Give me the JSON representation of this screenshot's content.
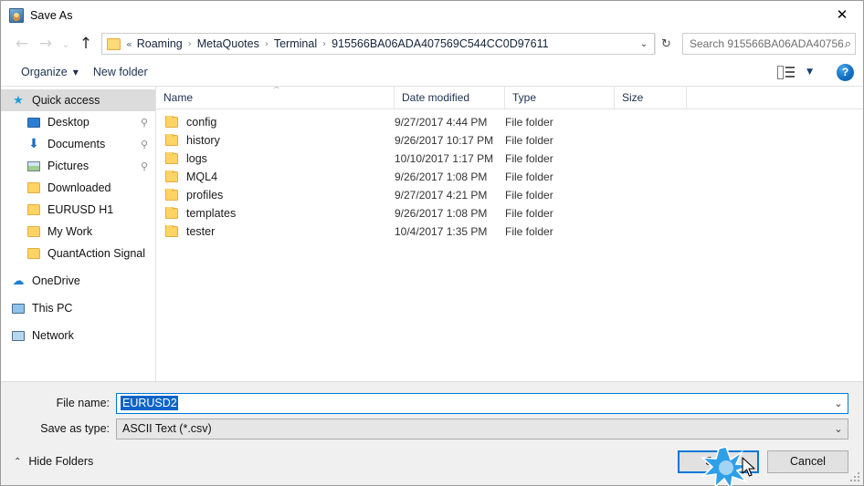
{
  "window": {
    "title": "Save As",
    "icon": "app-icon",
    "close_label": "✕"
  },
  "nav": {
    "back": "←",
    "forward": "→",
    "recent": "⌄",
    "up": "↑",
    "breadcrumb_prefix": "«",
    "breadcrumb": [
      "Roaming",
      "MetaQuotes",
      "Terminal",
      "915566BA06ADA407569C544CC0D97611"
    ],
    "separator": "›",
    "address_dropdown": "⌄",
    "refresh": "↻",
    "search_placeholder": "Search 915566BA06ADA40756...",
    "search_value": "",
    "search_icon": "⌕"
  },
  "toolbar": {
    "organize_label": "Organize",
    "organize_caret": "▼",
    "new_folder_label": "New folder",
    "view_caret": "▼",
    "help_label": "?"
  },
  "sidebar": {
    "items": [
      {
        "label": "Quick access",
        "icon": "star-icon",
        "indent": 0,
        "selected": true,
        "pinned": false
      },
      {
        "label": "Desktop",
        "icon": "desktop-icon",
        "indent": 1,
        "selected": false,
        "pinned": true
      },
      {
        "label": "Documents",
        "icon": "download-arrow-icon",
        "indent": 1,
        "selected": false,
        "pinned": true
      },
      {
        "label": "Pictures",
        "icon": "picture-icon",
        "indent": 1,
        "selected": false,
        "pinned": true
      },
      {
        "label": "Downloaded",
        "icon": "folder-icon",
        "indent": 1,
        "selected": false,
        "pinned": false
      },
      {
        "label": "EURUSD H1",
        "icon": "folder-icon",
        "indent": 1,
        "selected": false,
        "pinned": false
      },
      {
        "label": "My Work",
        "icon": "folder-icon",
        "indent": 1,
        "selected": false,
        "pinned": false
      },
      {
        "label": "QuantAction Signal",
        "icon": "folder-icon",
        "indent": 1,
        "selected": false,
        "pinned": false
      },
      {
        "label": "OneDrive",
        "icon": "onedrive-icon",
        "indent": 0,
        "selected": false,
        "pinned": false
      },
      {
        "label": "This PC",
        "icon": "computer-icon",
        "indent": 0,
        "selected": false,
        "pinned": false
      },
      {
        "label": "Network",
        "icon": "network-icon",
        "indent": 0,
        "selected": false,
        "pinned": false
      }
    ],
    "pin_glyph": "📌"
  },
  "filelist": {
    "columns": [
      "Name",
      "Date modified",
      "Type",
      "Size"
    ],
    "sort_caret": "^",
    "rows": [
      {
        "name": "config",
        "date": "9/27/2017 4:44 PM",
        "type": "File folder",
        "size": ""
      },
      {
        "name": "history",
        "date": "9/26/2017 10:17 PM",
        "type": "File folder",
        "size": ""
      },
      {
        "name": "logs",
        "date": "10/10/2017 1:17 PM",
        "type": "File folder",
        "size": ""
      },
      {
        "name": "MQL4",
        "date": "9/26/2017 1:08 PM",
        "type": "File folder",
        "size": ""
      },
      {
        "name": "profiles",
        "date": "9/27/2017 4:21 PM",
        "type": "File folder",
        "size": ""
      },
      {
        "name": "templates",
        "date": "9/26/2017 1:08 PM",
        "type": "File folder",
        "size": ""
      },
      {
        "name": "tester",
        "date": "10/4/2017 1:35 PM",
        "type": "File folder",
        "size": ""
      }
    ]
  },
  "form": {
    "filename_label": "File name:",
    "filename_value": "EURUSD2",
    "filename_dropdown": "⌄",
    "savetype_label": "Save as type:",
    "savetype_value": "ASCII Text (*.csv)",
    "savetype_dropdown": "⌄"
  },
  "footer": {
    "hide_folders_caret": "⌃",
    "hide_folders_label": "Hide Folders",
    "save_label": "Save",
    "cancel_label": "Cancel"
  },
  "colors": {
    "accent": "#0078d7",
    "selection": "#0c64c8",
    "folder": "#ffd464",
    "sidebar_selected": "#dcdcdc",
    "chrome": "#f0f0f0"
  }
}
